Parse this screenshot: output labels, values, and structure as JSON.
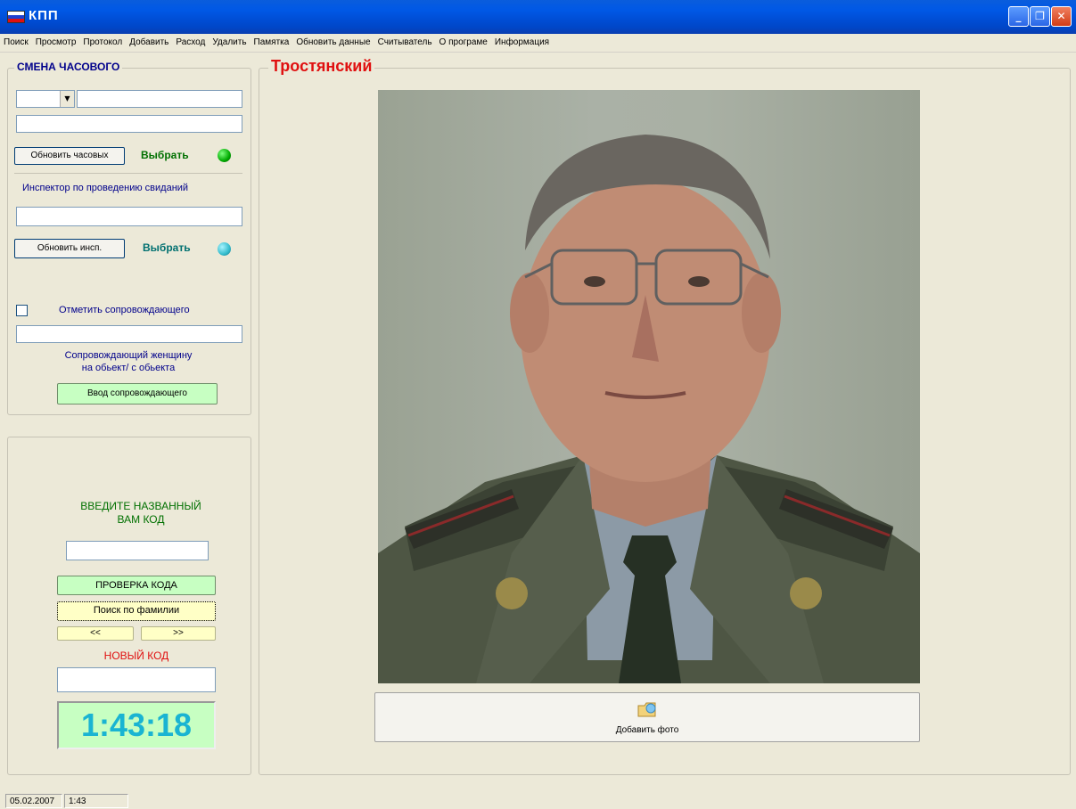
{
  "window": {
    "title": "КПП",
    "minimize": "_",
    "maximize": "❐",
    "close": "✕"
  },
  "menu": [
    "Поиск",
    "Просмотр",
    "Протокол",
    "Добавить",
    "Расход",
    "Удалить",
    "Памятка",
    "Обновить данные",
    "Считыватель",
    "О програме",
    "Информация"
  ],
  "left_panel": {
    "group_title": "СМЕНА ЧАСОВОГО",
    "refresh_guards_label": "Обновить часовых",
    "select_label_1": "Выбрать",
    "inspector_label": "Инспектор по проведению свиданий",
    "refresh_inspector_label": "Обновить инсп.",
    "select_label_2": "Выбрать",
    "mark_escort_label": "Отметить сопровождающего",
    "escort_desc_line1": "Сопровождающий женщину",
    "escort_desc_line2": "на обьект/ с обьекта",
    "escort_input_button": "Ввод сопровождающего",
    "led_colors": [
      "#00aa00",
      "#33bbcc"
    ]
  },
  "code_panel": {
    "prompt_line1": "ВВЕДИТЕ НАЗВАННЫЙ",
    "prompt_line2": "ВАМ КОД",
    "check_code_button": "ПРОВЕРКА КОДА",
    "search_surname_button": "Поиск по фамилии",
    "prev_button": "<<",
    "next_button": ">>",
    "new_code_label": "НОВЫЙ КОД",
    "clock": "1:43:18"
  },
  "main": {
    "person_name": "Тростянский",
    "add_photo_label": "Добавить фото"
  },
  "status": {
    "date": "05.02.2007",
    "time": "1:43"
  },
  "colors": {
    "title_red": "#e01010",
    "green_text": "#007000",
    "blue_text": "#00008b",
    "clock_text": "#19b4d2",
    "clock_bg": "#c7ffc2"
  }
}
